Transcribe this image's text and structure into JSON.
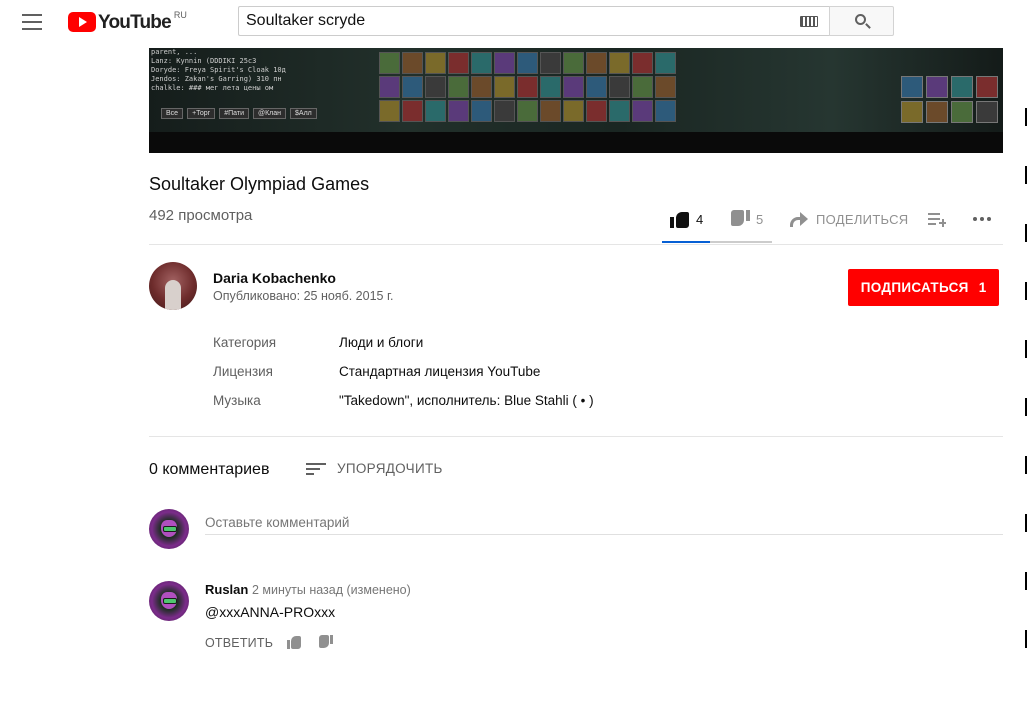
{
  "header": {
    "logo_text": "YouTube",
    "logo_region": "RU",
    "search_value": "Soultaker scryde"
  },
  "video": {
    "chat_lines": [
      "parent, ...",
      "Lanz: Kynnin (DDDIKI 25c3",
      "Doryde: Freya Spirit's Cloak  10д",
      "Jendos: Zakan's Garring)  310 пн",
      "chalkle: ###  мег лета  цены ом"
    ],
    "chat_tabs": [
      "Все",
      "+Торг",
      "#Пати",
      "@Клан",
      "$Алл"
    ],
    "title": "Soultaker Olympiad Games",
    "views": "492 просмотра",
    "likes": "4",
    "dislikes": "5",
    "share_label": "ПОДЕЛИТЬСЯ",
    "like_fraction": 0.44
  },
  "owner": {
    "name": "Daria Kobachenko",
    "published": "Опубликовано: 25 нояб. 2015 г.",
    "subscribe_label": "ПОДПИСАТЬСЯ",
    "subscriber_count": "1"
  },
  "metadata": [
    {
      "key": "Категория",
      "value": "Люди и блоги"
    },
    {
      "key": "Лицензия",
      "value": "Стандартная лицензия YouTube"
    },
    {
      "key": "Музыка",
      "value": "\"Takedown\", исполнитель: Blue Stahli ( • )"
    }
  ],
  "comments": {
    "count_label": "0 комментариев",
    "sort_label": "УПОРЯДОЧИТЬ",
    "input_placeholder": "Оставьте комментарий",
    "items": [
      {
        "author": "Ruslan",
        "time": "2 минуты назад (изменено)",
        "text": "@xxxANNA-PROxxx",
        "reply_label": "ОТВЕТИТЬ"
      }
    ]
  },
  "colors": {
    "brand_red": "#ff0000",
    "accent_blue": "#065fd4",
    "text_primary": "#0d0d0d",
    "text_secondary": "#606060"
  },
  "icons": [
    "menu-icon",
    "youtube-logo-icon",
    "keyboard-icon",
    "search-icon",
    "thumb-up-icon",
    "thumb-down-icon",
    "share-icon",
    "add-to-playlist-icon",
    "more-icon",
    "sort-icon"
  ]
}
